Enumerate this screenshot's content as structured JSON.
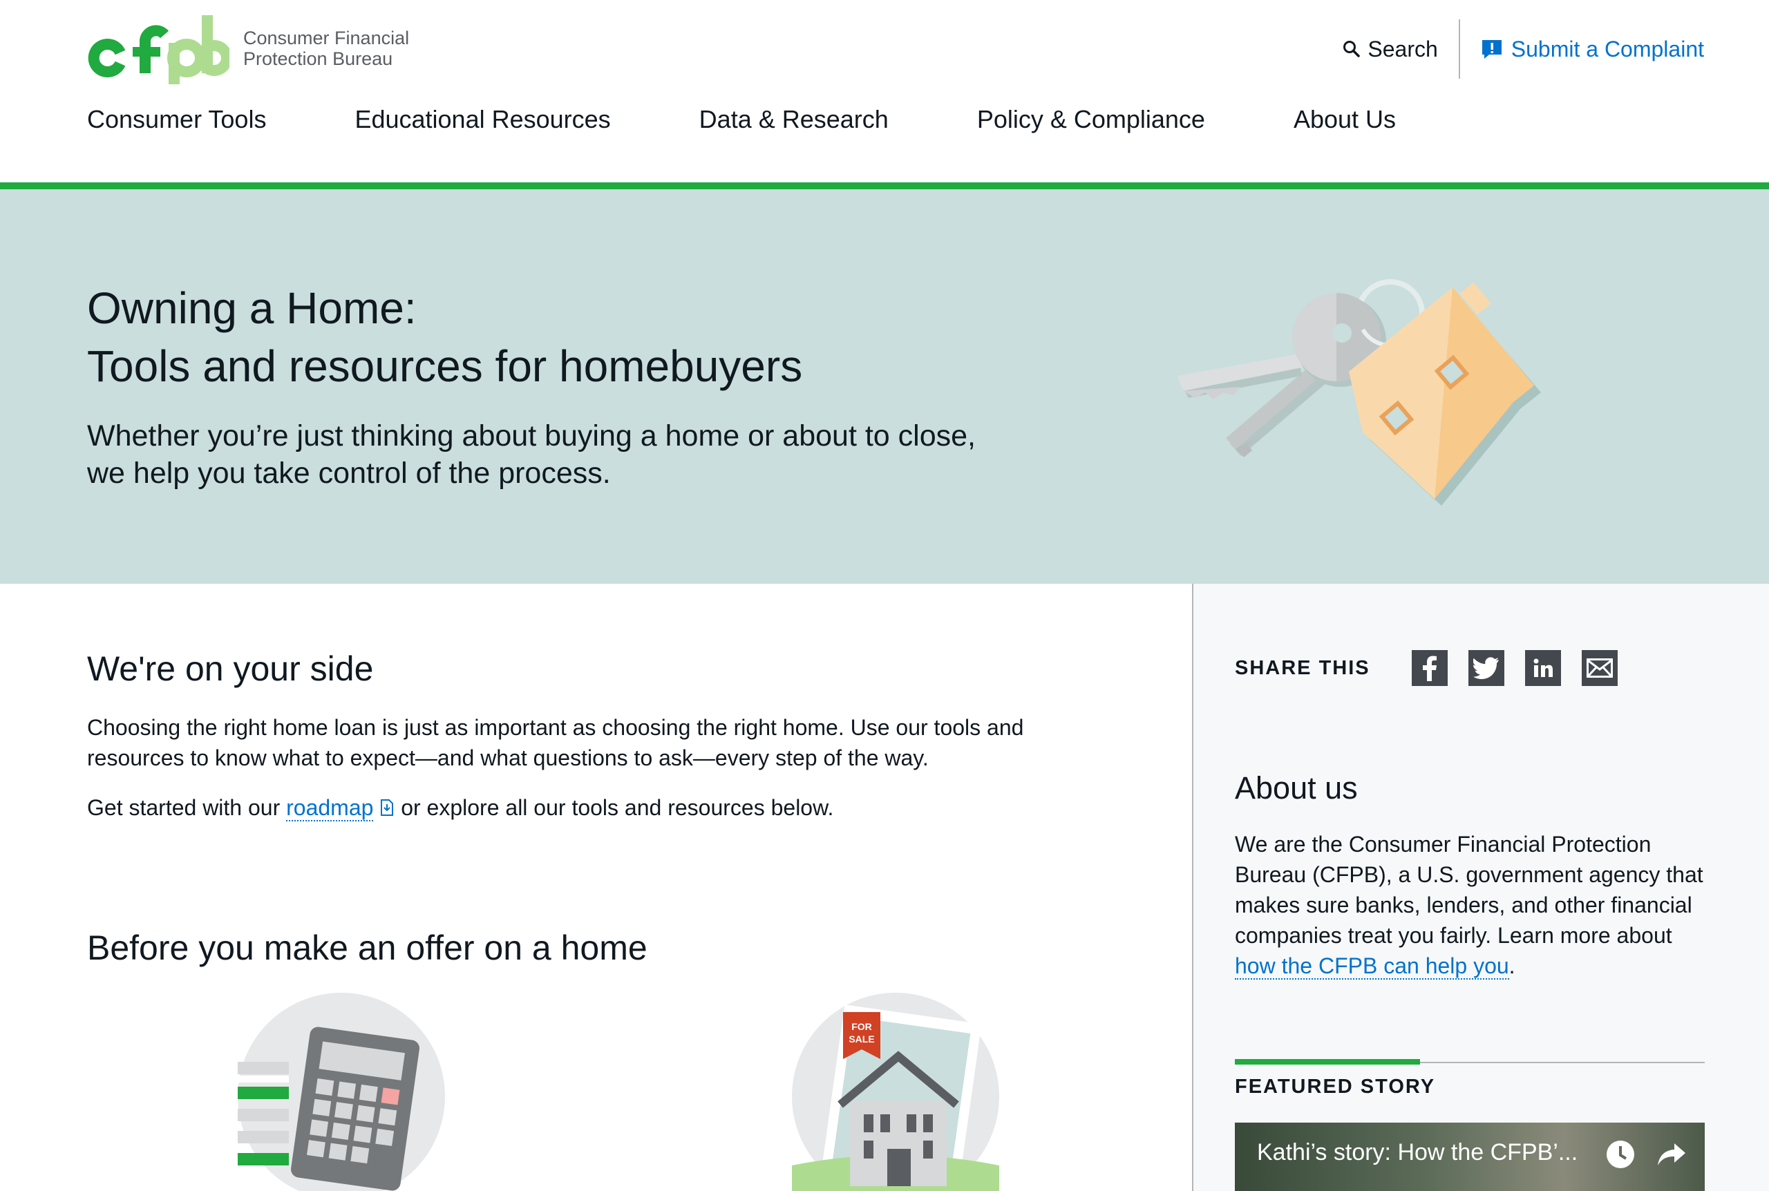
{
  "header": {
    "logo_text_line1": "Consumer Financial",
    "logo_text_line2": "Protection Bureau",
    "search_label": "Search",
    "complaint_label": "Submit a Complaint"
  },
  "nav": {
    "items": [
      {
        "label": "Consumer Tools"
      },
      {
        "label": "Educational Resources"
      },
      {
        "label": "Data & Research"
      },
      {
        "label": "Policy & Compliance"
      },
      {
        "label": "About Us"
      }
    ]
  },
  "hero": {
    "title_line1": "Owning a Home:",
    "title_line2": "Tools and resources for homebuyers",
    "subtitle": "Whether you’re just thinking about buying a home or about to close, we help you take control of the process."
  },
  "main": {
    "side_heading": "We're on your side",
    "intro": "Choosing the right home loan is just as important as choosing the right home. Use our tools and resources to know what to expect—and what questions to ask—every step of the way.",
    "getstarted_prefix": "Get started with our",
    "roadmap_link": "roadmap",
    "getstarted_suffix": "or explore all our tools and resources below.",
    "before_heading": "Before you make an offer on a home",
    "tile2_sign": "FOR SALE"
  },
  "sidebar": {
    "share_label": "SHARE THIS",
    "share_buttons": [
      "facebook-icon",
      "twitter-icon",
      "linkedin-icon",
      "email-icon"
    ],
    "about_heading": "About us",
    "about_text": "We are the Consumer Financial Protection Bureau (CFPB), a U.S. government agency that makes sure banks, lenders, and other financial companies treat you fairly. Learn more about",
    "about_link": "how the CFPB can help you",
    "featured_label": "FEATURED STORY",
    "video_title": "Kathi’s story: How the CFPB’..."
  },
  "colors": {
    "brand_green": "#20aa3f",
    "link_blue": "#0072ce",
    "hero_bg": "#c9dedd",
    "sidebar_bg": "#f7f8f9",
    "share_button_bg": "#43484e"
  }
}
